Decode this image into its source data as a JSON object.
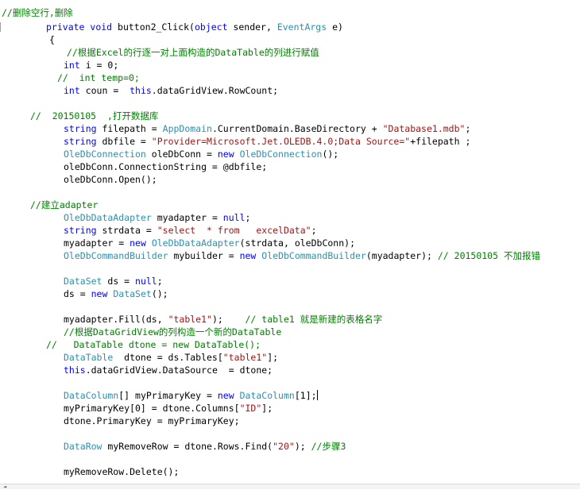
{
  "code": {
    "l0": {
      "comment": "//删除空行,删除"
    },
    "l1": {
      "kw1": "private",
      "kw2": "void",
      "text": " button2_Click(",
      "kw3": "object",
      "text2": " sender, ",
      "type": "EventArgs",
      "text3": " e)"
    },
    "l2": {
      "text": "{"
    },
    "l3": {
      "comment": "//根据Excel的行逐一对上面构造的DataTable的列进行赋值"
    },
    "l4": {
      "kw": "int",
      "text": " i = 0;"
    },
    "l5": {
      "comment": "//  int temp=0;"
    },
    "l6": {
      "kw": "int",
      "text": " coun =  ",
      "kw2": "this",
      "text2": ".dataGridView.RowCount;"
    },
    "l7": {
      "comment": "//  20150105  ,打开数据库"
    },
    "l8": {
      "kw": "string",
      "text": " filepath = ",
      "type": "AppDomain",
      "text2": ".CurrentDomain.BaseDirectory + ",
      "str": "\"Database1.mdb\"",
      "text3": ";"
    },
    "l9": {
      "kw": "string",
      "text": " dbfile = ",
      "str": "\"Provider=Microsoft.Jet.OLEDB.4.0;Data Source=\"",
      "text2": "+filepath ;"
    },
    "l10": {
      "type": "OleDbConnection",
      "text": " oleDbConn = ",
      "kw": "new",
      "text2": " ",
      "type2": "OleDbConnection",
      "text3": "();"
    },
    "l11": {
      "text": "oleDbConn.ConnectionString = @dbfile;"
    },
    "l12": {
      "text": "oleDbConn.Open();"
    },
    "l13": {
      "comment": "//建立adapter"
    },
    "l14": {
      "type": "OleDbDataAdapter",
      "text": " myadapter = ",
      "kw": "null",
      "text2": ";"
    },
    "l15": {
      "kw": "string",
      "text": " strdata = ",
      "str": "\"select  * from   excelData\"",
      "text2": ";"
    },
    "l16": {
      "text": "myadapter = ",
      "kw": "new",
      "text2": " ",
      "type": "OleDbDataAdapter",
      "text3": "(strdata, oleDbConn);"
    },
    "l17": {
      "type": "OleDbCommandBuilder",
      "text": " mybuilder = ",
      "kw": "new",
      "text2": " ",
      "type2": "OleDbCommandBuilder",
      "text3": "(myadapter); ",
      "comment": "// 20150105 不加报错"
    },
    "l18": {
      "type": "DataSet",
      "text": " ds = ",
      "kw": "null",
      "text2": ";"
    },
    "l19": {
      "text": "ds = ",
      "kw": "new",
      "text2": " ",
      "type": "DataSet",
      "text3": "();"
    },
    "l20": {
      "text": "myadapter.Fill(ds, ",
      "str": "\"table1\"",
      "text2": ");    ",
      "comment": "// table1 就是新建的表格名字"
    },
    "l21": {
      "comment": "//根据DataGridView的列构造一个新的DataTable"
    },
    "l22": {
      "comment": "//   DataTable dtone = new DataTable();"
    },
    "l23": {
      "type": "DataTable",
      "text": "  dtone = ds.Tables[",
      "str": "\"table1\"",
      "text2": "];"
    },
    "l24": {
      "kw": "this",
      "text": ".dataGridView.DataSource  = dtone;"
    },
    "l25": {
      "type": "DataColumn",
      "text": "[] myPrimaryKey = ",
      "kw": "new",
      "text2": " ",
      "type2": "DataColumn",
      "text3": "[1];"
    },
    "l26": {
      "text": "myPrimaryKey[0] = dtone.Columns[",
      "str": "\"ID\"",
      "text2": "];"
    },
    "l27": {
      "text": "dtone.PrimaryKey = myPrimaryKey;"
    },
    "l28": {
      "type": "DataRow",
      "text": " myRemoveRow = dtone.Rows.Find(",
      "str": "\"20\"",
      "text2": "); ",
      "comment": "//步骤3"
    },
    "l29": {
      "text": "myRemoveRow.Delete();"
    }
  },
  "colors": {
    "keyword": "#0000ff",
    "type": "#2b91af",
    "string": "#a31515",
    "comment": "#008000"
  }
}
